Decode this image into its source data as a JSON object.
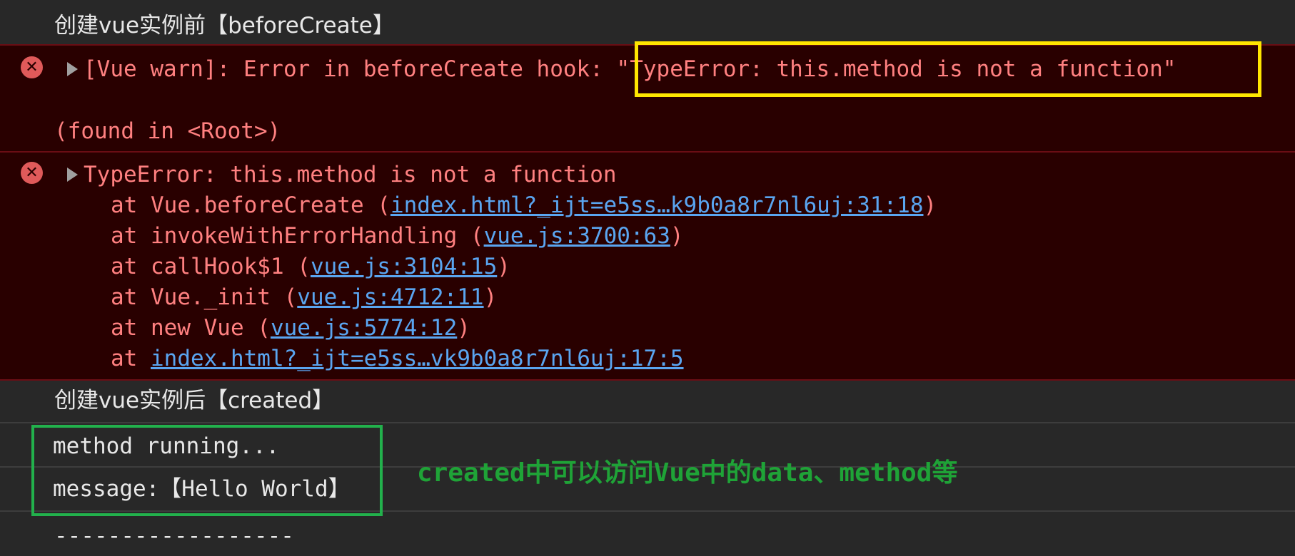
{
  "console": {
    "before_create_log": "创建vue实例前【beforeCreate】",
    "warn": {
      "prefix": "[Vue warn]: Error in beforeCreate hook: ",
      "error_string": "\"TypeError: this.method is not a function\"",
      "found_in": "(found in <Root>)"
    },
    "type_error": {
      "message": "TypeError: this.method is not a function",
      "stack": [
        {
          "pre": "at Vue.beforeCreate (",
          "link": "index.html?_ijt=e5ss…k9b0a8r7nl6uj:31:18",
          "post": ")"
        },
        {
          "pre": "at invokeWithErrorHandling (",
          "link": "vue.js:3700:63",
          "post": ")"
        },
        {
          "pre": "at callHook$1 (",
          "link": "vue.js:3104:15",
          "post": ")"
        },
        {
          "pre": "at Vue._init (",
          "link": "vue.js:4712:11",
          "post": ")"
        },
        {
          "pre": "at new Vue (",
          "link": "vue.js:5774:12",
          "post": ")"
        },
        {
          "pre": "at ",
          "link": "index.html?_ijt=e5ss…vk9b0a8r7nl6uj:17:5",
          "post": ""
        }
      ]
    },
    "created_log": "创建vue实例后【created】",
    "method_log": "method running...",
    "message_log": "message:【Hello World】",
    "divider_log": "------------------",
    "annotation": "created中可以访问Vue中的data、method等"
  },
  "colors": {
    "background": "#282828",
    "error_background": "#290000",
    "error_text": "#ff8080",
    "link": "#5aa5f0",
    "highlight_yellow": "#ffe600",
    "highlight_green": "#22b14c",
    "annotation": "#1fa337"
  },
  "icons": {
    "error": "error-circle-icon",
    "expand": "disclosure-triangle-icon"
  }
}
